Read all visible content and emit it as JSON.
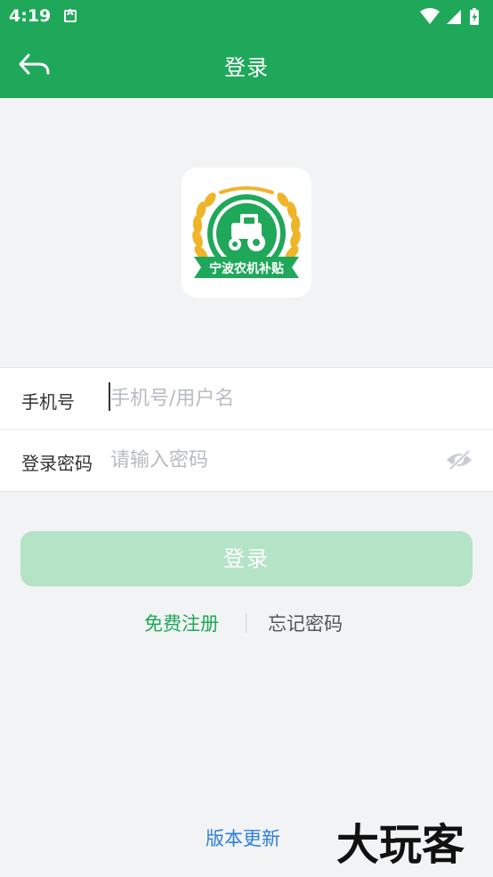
{
  "status_bar": {
    "time": "4:19"
  },
  "header": {
    "title": "登录"
  },
  "logo": {
    "text": "宁波农机补贴"
  },
  "form": {
    "phone_label": "手机号",
    "phone_placeholder": "手机号/用户名",
    "password_label": "登录密码",
    "password_placeholder": "请输入密码"
  },
  "actions": {
    "login_label": "登录",
    "register_label": "免费注册",
    "forgot_label": "忘记密码",
    "version_label": "版本更新"
  },
  "watermark": {
    "text": "大玩客"
  },
  "colors": {
    "primary": "#1fa85a",
    "login_button_disabled": "#b4e3c6",
    "link_blue": "#2f7fd8",
    "wheat": "#f0b429"
  },
  "icons": {
    "back": "back-arrow-icon",
    "eye": "eye-off-icon",
    "wifi": "wifi-icon",
    "signal": "signal-icon",
    "battery": "battery-charging-icon"
  }
}
